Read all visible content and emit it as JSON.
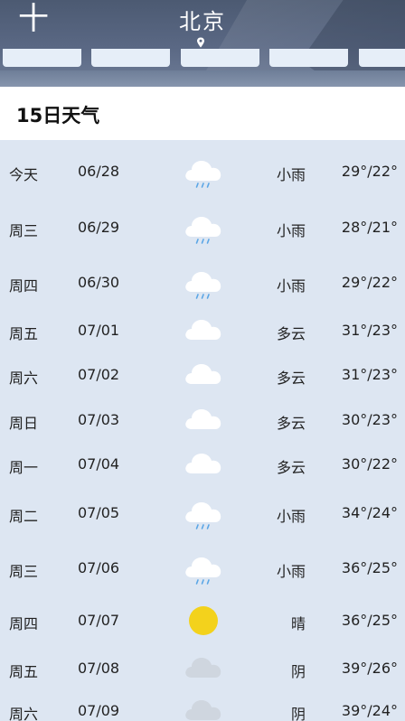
{
  "header": {
    "add_label": "十",
    "city": "北京"
  },
  "title": "15日天气",
  "days": [
    {
      "day": "今天",
      "date": "06/28",
      "icon": "rain-cloud-icon",
      "condition": "小雨",
      "temp": "29°/22°"
    },
    {
      "day": "周三",
      "date": "06/29",
      "icon": "rain-cloud-icon",
      "condition": "小雨",
      "temp": "28°/21°"
    },
    {
      "day": "周四",
      "date": "06/30",
      "icon": "rain-cloud-icon",
      "condition": "小雨",
      "temp": "29°/22°"
    },
    {
      "day": "周五",
      "date": "07/01",
      "icon": "cloud-icon",
      "condition": "多云",
      "temp": "31°/23°"
    },
    {
      "day": "周六",
      "date": "07/02",
      "icon": "cloud-icon",
      "condition": "多云",
      "temp": "31°/23°"
    },
    {
      "day": "周日",
      "date": "07/03",
      "icon": "cloud-icon",
      "condition": "多云",
      "temp": "30°/23°"
    },
    {
      "day": "周一",
      "date": "07/04",
      "icon": "cloud-icon",
      "condition": "多云",
      "temp": "30°/22°"
    },
    {
      "day": "周二",
      "date": "07/05",
      "icon": "rain-cloud-icon",
      "condition": "小雨",
      "temp": "34°/24°"
    },
    {
      "day": "周三",
      "date": "07/06",
      "icon": "rain-cloud-icon",
      "condition": "小雨",
      "temp": "36°/25°"
    },
    {
      "day": "周四",
      "date": "07/07",
      "icon": "sun-icon",
      "condition": "晴",
      "temp": "36°/25°"
    },
    {
      "day": "周五",
      "date": "07/08",
      "icon": "overcast-cloud-icon",
      "condition": "阴",
      "temp": "39°/26°"
    },
    {
      "day": "周六",
      "date": "07/09",
      "icon": "overcast-cloud-icon",
      "condition": "阴",
      "temp": "39°/24°"
    }
  ],
  "colors": {
    "header": "#5a6884",
    "list_bg": "#dde6f2",
    "sun": "#f3d21c",
    "rain": "#5aa6e6"
  }
}
